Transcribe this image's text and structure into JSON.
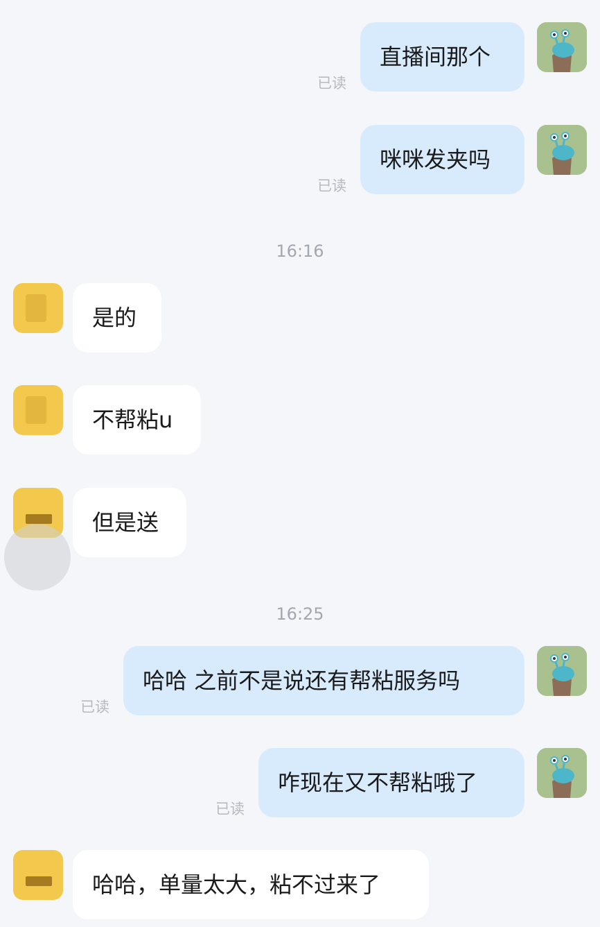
{
  "messages": [
    {
      "side": "me",
      "text": "直播间那个",
      "status": "已读"
    },
    {
      "side": "me",
      "text": "咪咪发夹吗",
      "status": "已读"
    },
    {
      "type": "time",
      "text": "16:16"
    },
    {
      "side": "them",
      "text": "是的"
    },
    {
      "side": "them",
      "text": "不帮粘u"
    },
    {
      "side": "them",
      "text": "但是送"
    },
    {
      "type": "time",
      "text": "16:25"
    },
    {
      "side": "me",
      "text": "哈哈 之前不是说还有帮粘服务吗",
      "status": "已读"
    },
    {
      "side": "me",
      "text": "咋现在又不帮粘哦了",
      "status": "已读"
    },
    {
      "side": "them",
      "text": "哈哈，单量太大，粘不过来了"
    }
  ],
  "colors": {
    "background": "#f4f6fa",
    "outgoing_bubble": "#d8ebfd",
    "incoming_bubble": "#ffffff",
    "my_avatar": "#a9c18e",
    "their_avatar": "#f2c94c"
  },
  "icons": {
    "my_avatar": "snail-avatar-icon",
    "their_avatar": "blurred-avatar-icon"
  }
}
